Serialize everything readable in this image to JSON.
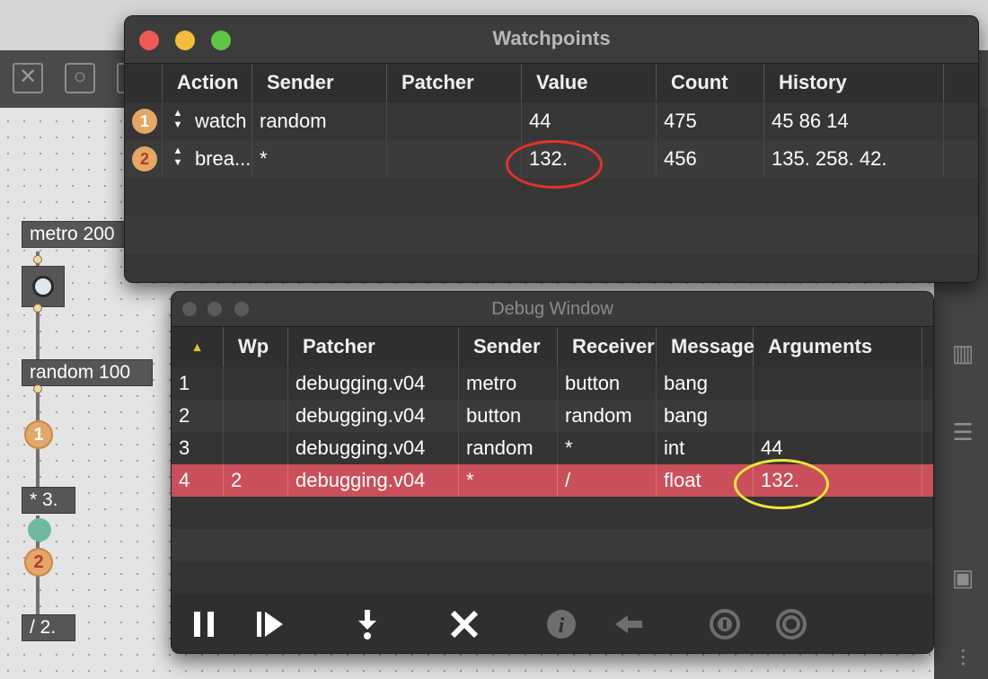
{
  "patcher": {
    "objects": {
      "metro": "metro 200",
      "random": "random 100",
      "multiply": "* 3.",
      "divide": "/ 2."
    },
    "badges": [
      "1",
      "2"
    ]
  },
  "watchpoints": {
    "title": "Watchpoints",
    "columns": [
      "Action",
      "Sender",
      "Patcher",
      "Value",
      "Count",
      "History"
    ],
    "rows": [
      {
        "num": "1",
        "action": "watch",
        "sender": "random",
        "patcher": "",
        "value": "44",
        "count": "475",
        "history": "45 86 14"
      },
      {
        "num": "2",
        "action": "brea...",
        "sender": "*",
        "patcher": "",
        "value": "132.",
        "count": "456",
        "history": "135. 258. 42."
      }
    ]
  },
  "debug": {
    "title": "Debug Window",
    "columns": [
      "Wp",
      "Patcher",
      "Sender",
      "Receiver",
      "Message",
      "Arguments"
    ],
    "rows": [
      {
        "n": "1",
        "wp": "",
        "patcher": "debugging.v04",
        "sender": "metro",
        "receiver": "button",
        "message": "bang",
        "args": ""
      },
      {
        "n": "2",
        "wp": "",
        "patcher": "debugging.v04",
        "sender": "button",
        "receiver": "random",
        "message": "bang",
        "args": ""
      },
      {
        "n": "3",
        "wp": "",
        "patcher": "debugging.v04",
        "sender": "random",
        "receiver": "*",
        "message": "int",
        "args": "44"
      },
      {
        "n": "4",
        "wp": "2",
        "patcher": "debugging.v04",
        "sender": "*",
        "receiver": "/",
        "message": "float",
        "args": "132."
      }
    ],
    "selected_row": "4",
    "toolbar": [
      "pause-icon",
      "step-icon",
      "step-into-icon",
      "clear-icon",
      "info-icon",
      "back-arrow-icon",
      "watch-info-icon",
      "watch-icon"
    ]
  },
  "colors": {
    "selected_row": "#c9505a",
    "badge": "#e3a767",
    "value_highlight": "#e0332b",
    "argument_highlight": "#f2e63a"
  }
}
